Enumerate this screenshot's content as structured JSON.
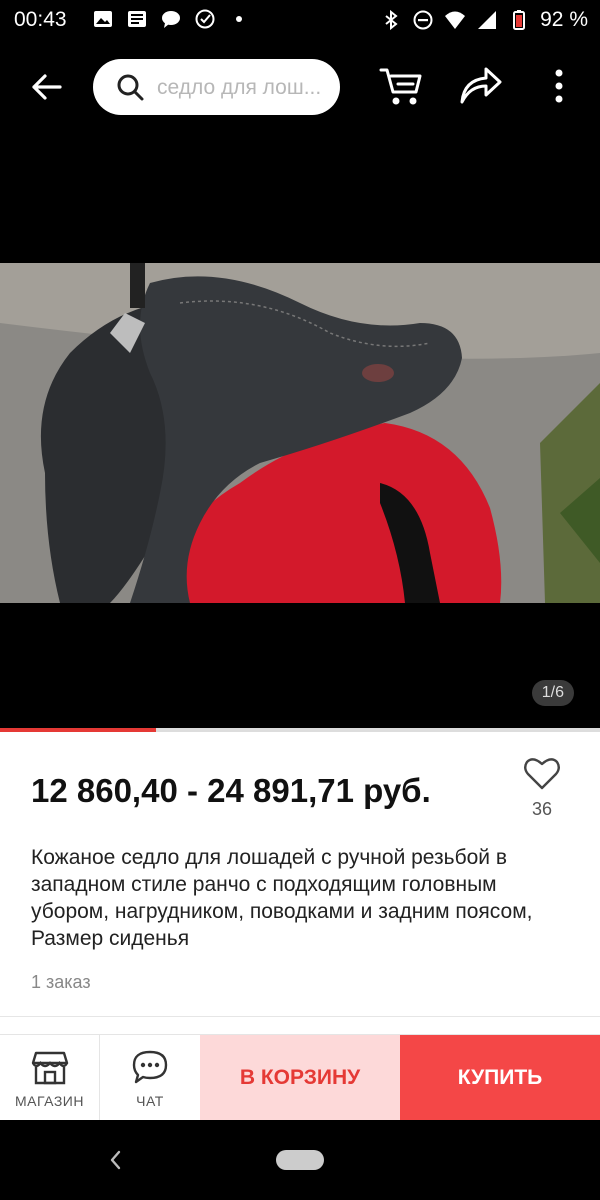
{
  "status_bar": {
    "time": "00:43",
    "battery": "92 %",
    "icons": [
      "image-icon",
      "news-icon",
      "chat-bubble-icon",
      "check-circle-icon",
      "dot-icon",
      "bluetooth-icon",
      "dnd-icon",
      "wifi-icon",
      "signal-icon",
      "battery-icon"
    ]
  },
  "app_bar": {
    "search_placeholder": "седло для лош...",
    "icons": [
      "back-arrow-icon",
      "search-icon",
      "cart-icon",
      "share-icon",
      "more-vertical-icon"
    ]
  },
  "media": {
    "counter": "1/6",
    "progress_fraction": 0.26
  },
  "product": {
    "price": "12 860,40 - 24 891,71 руб.",
    "wishlist_count": "36",
    "title": "Кожаное седло для лошадей с ручной резьбой в западном стиле ранчо с подходящим головным убором, нагрудником, поводками и задним поясом, Размер сиденья",
    "orders": "1 заказ"
  },
  "actions": {
    "shop_label": "МАГАЗИН",
    "chat_label": "ЧАТ",
    "add_to_cart_label": "В КОРЗИНУ",
    "buy_label": "КУПИТЬ"
  },
  "colors": {
    "accent": "#e53935",
    "buy_bg": "#f44747",
    "cart_bg": "#fdd9d9"
  }
}
